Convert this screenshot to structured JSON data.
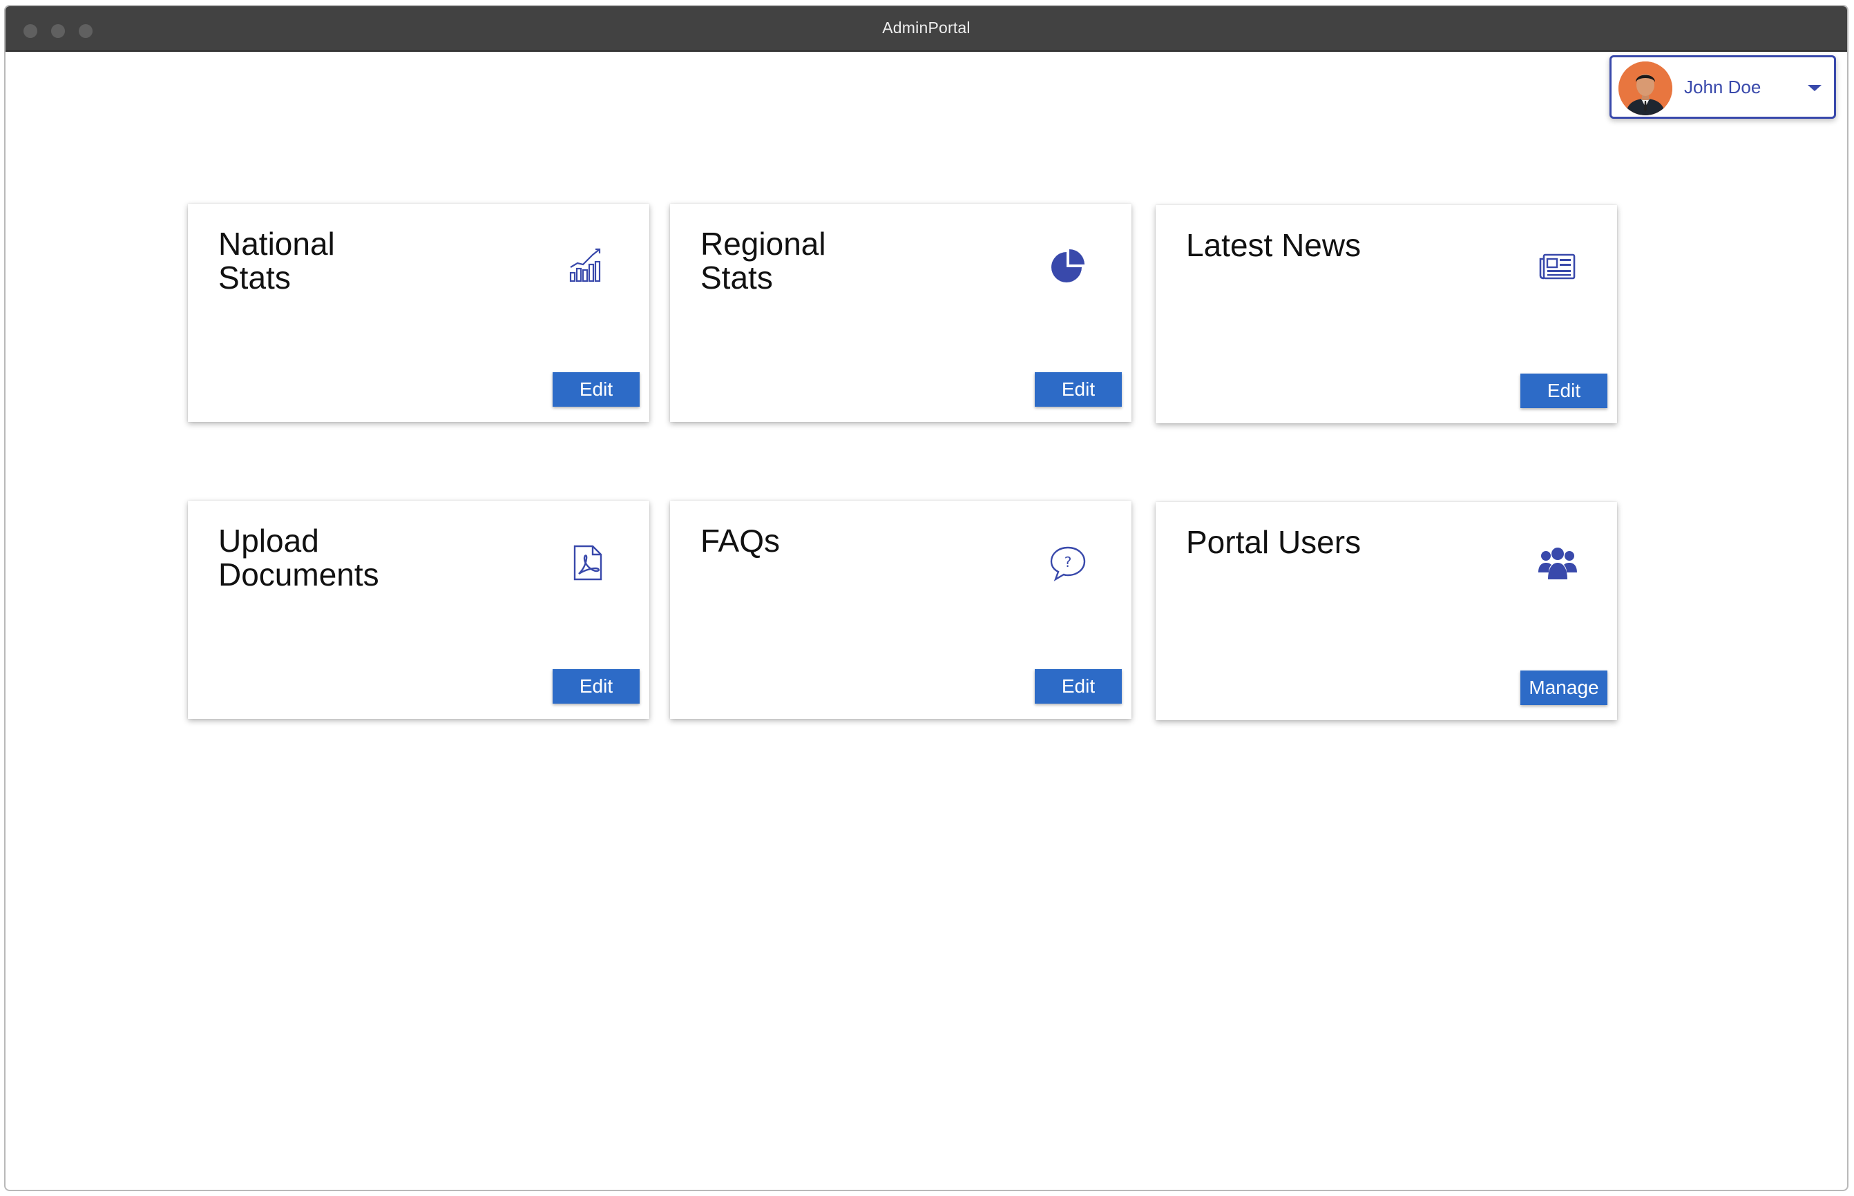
{
  "window": {
    "title": "AdminPortal"
  },
  "user_menu": {
    "name": "John Doe",
    "avatar_icon": "user-avatar-photo",
    "dropdown_icon": "caret-down-icon"
  },
  "colors": {
    "accent": "#3949ab",
    "button": "#2d6bc7",
    "titlebar": "#424242",
    "avatar_bg": "#e8763f"
  },
  "cards": [
    {
      "title": "National\nStats",
      "icon": "bar-line-chart-icon",
      "button_label": "Edit"
    },
    {
      "title": "Regional\nStats",
      "icon": "pie-chart-icon",
      "button_label": "Edit"
    },
    {
      "title": "Latest News",
      "icon": "newspaper-icon",
      "button_label": "Edit"
    },
    {
      "title": "Upload\nDocuments",
      "icon": "pdf-file-icon",
      "button_label": "Edit"
    },
    {
      "title": "FAQs",
      "icon": "question-bubble-icon",
      "button_label": "Edit"
    },
    {
      "title": "Portal Users",
      "icon": "users-group-icon",
      "button_label": "Manage"
    }
  ]
}
